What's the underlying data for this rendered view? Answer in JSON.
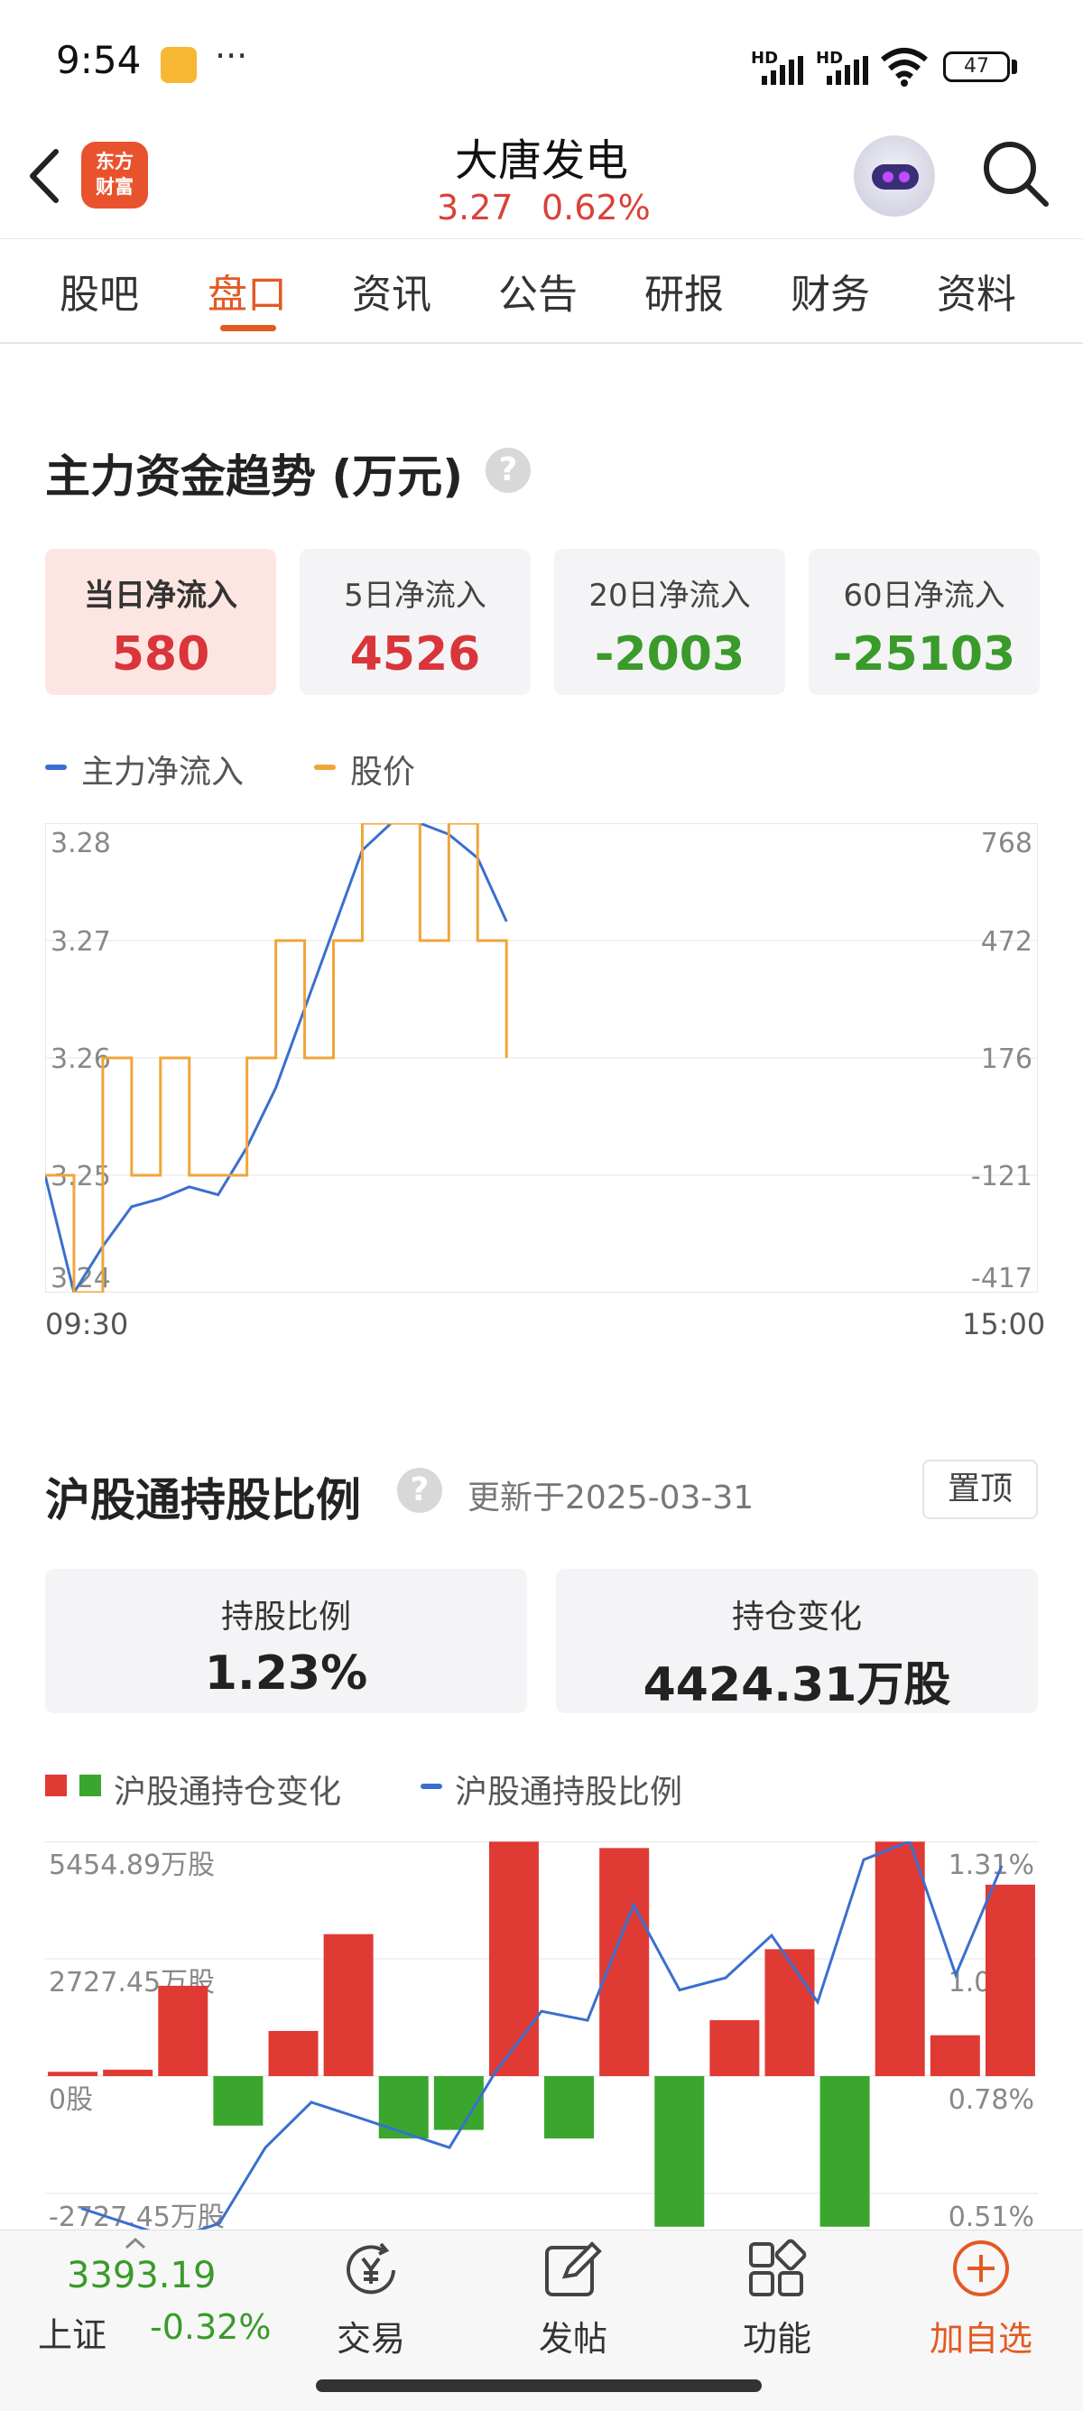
{
  "status_bar": {
    "time": "9:54",
    "more": "···",
    "signal1": "HD",
    "signal2": "HD",
    "battery": "47"
  },
  "header": {
    "logo_line1": "东方",
    "logo_line2": "财富",
    "stock_name": "大唐发电",
    "price": "3.27",
    "change": "0.62%"
  },
  "tabs": [
    {
      "label": "股吧"
    },
    {
      "label": "盘口"
    },
    {
      "label": "资讯"
    },
    {
      "label": "公告"
    },
    {
      "label": "研报"
    },
    {
      "label": "财务"
    },
    {
      "label": "资料"
    }
  ],
  "fund_trend": {
    "title": "主力资金趋势 (万元)",
    "help": "?",
    "cards": [
      {
        "label": "当日净流入",
        "value": "580"
      },
      {
        "label": "5日净流入",
        "value": "4526"
      },
      {
        "label": "20日净流入",
        "value": "-2003"
      },
      {
        "label": "60日净流入",
        "value": "-25103"
      }
    ],
    "legend_main": "主力净流入",
    "legend_price": "股价",
    "x_start": "09:30",
    "x_end": "15:00"
  },
  "hk_holding": {
    "title": "沪股通持股比例",
    "help": "?",
    "updated": "更新于2025-03-31",
    "pin": "置顶",
    "ratio_label": "持股比例",
    "ratio_value": "1.23%",
    "change_label": "持仓变化",
    "change_value": "4424.31万股",
    "legend_change": "沪股通持仓变化",
    "legend_ratio": "沪股通持股比例"
  },
  "chart_data": [
    {
      "type": "line",
      "title": "主力资金趋势 (万元)",
      "x_range": [
        "09:30",
        "15:00"
      ],
      "y_left_ticks": [
        "3.28",
        "3.27",
        "3.26",
        "3.25",
        "3.24"
      ],
      "y_right_ticks": [
        "768",
        "472",
        "176",
        "-121",
        "-417"
      ],
      "ylim_left": [
        3.24,
        3.28
      ],
      "ylim_right": [
        -417,
        768
      ],
      "grid": true,
      "series": [
        {
          "name": "主力净流入",
          "color": "#3a6fcf",
          "axis": "right",
          "values": [
            -121,
            -417,
            -300,
            -200,
            -180,
            -150,
            -170,
            -50,
            100,
            300,
            500,
            700,
            768,
            768,
            740,
            680,
            520
          ]
        },
        {
          "name": "股价",
          "color": "#f0a53a",
          "axis": "left",
          "values": [
            3.25,
            3.24,
            3.26,
            3.25,
            3.26,
            3.25,
            3.25,
            3.26,
            3.27,
            3.26,
            3.27,
            3.28,
            3.28,
            3.27,
            3.28,
            3.27,
            3.26
          ]
        }
      ]
    },
    {
      "type": "bar",
      "title": "沪股通持股比例",
      "y_left_ticks": [
        "5454.89万股",
        "2727.45万股",
        "0股",
        "-2727.45万股"
      ],
      "y_right_ticks": [
        "1.31%",
        "1.05%",
        "0.78%",
        "0.51%"
      ],
      "ylim_left": [
        -5454.89,
        5454.89
      ],
      "ylim_right": [
        0.24,
        1.31
      ],
      "grid": true,
      "series": [
        {
          "name": "沪股通持仓变化",
          "color_pos": "#e03a35",
          "color_neg": "#3aa62e",
          "values": [
            100,
            150,
            2100,
            -1150,
            1050,
            3300,
            -1450,
            -1250,
            5450,
            -1450,
            5300,
            -3500,
            1300,
            2950,
            -3500,
            5450,
            950,
            4450
          ]
        },
        {
          "name": "沪股通持股比例",
          "color": "#3a6fcf",
          "values": [
            0.1,
            0.05,
            0.0,
            0.05,
            0.3,
            0.45,
            0.4,
            0.35,
            0.3,
            0.55,
            0.75,
            0.72,
            1.1,
            0.82,
            0.86,
            1.0,
            0.78,
            1.25,
            1.31,
            0.87,
            1.23
          ]
        }
      ]
    }
  ],
  "bottom_nav": {
    "index_value": "3393.19",
    "index_name": "上证",
    "index_change": "-0.32%",
    "trade": "交易",
    "post": "发帖",
    "features": "功能",
    "add_watch": "加自选"
  },
  "colors": {
    "accent": "#e35a24",
    "up": "#d9353a",
    "down": "#3a9a2a",
    "line_blue": "#3a6fcf",
    "line_orange": "#f0a53a"
  }
}
